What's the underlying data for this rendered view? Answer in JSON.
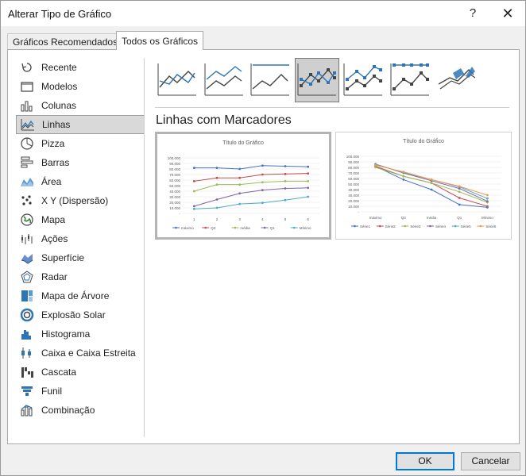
{
  "window": {
    "title": "Alterar Tipo de Gráfico",
    "help_label": "?",
    "close_label": "✕"
  },
  "tabs": [
    {
      "label": "Gráficos Recomendados",
      "selected": false
    },
    {
      "label": "Todos os Gráficos",
      "selected": true
    }
  ],
  "sidebar": {
    "items": [
      {
        "label": "Recente",
        "icon": "recent-icon"
      },
      {
        "label": "Modelos",
        "icon": "folder-icon"
      },
      {
        "label": "Colunas",
        "icon": "column-chart-icon"
      },
      {
        "label": "Linhas",
        "icon": "line-chart-icon",
        "selected": true
      },
      {
        "label": "Pizza",
        "icon": "pie-chart-icon"
      },
      {
        "label": "Barras",
        "icon": "bar-chart-icon"
      },
      {
        "label": "Área",
        "icon": "area-chart-icon"
      },
      {
        "label": "X Y (Dispersão)",
        "icon": "scatter-chart-icon"
      },
      {
        "label": "Mapa",
        "icon": "map-chart-icon"
      },
      {
        "label": "Ações",
        "icon": "stock-chart-icon"
      },
      {
        "label": "Superfície",
        "icon": "surface-chart-icon"
      },
      {
        "label": "Radar",
        "icon": "radar-chart-icon"
      },
      {
        "label": "Mapa de Árvore",
        "icon": "treemap-chart-icon"
      },
      {
        "label": "Explosão Solar",
        "icon": "sunburst-chart-icon"
      },
      {
        "label": "Histograma",
        "icon": "histogram-chart-icon"
      },
      {
        "label": "Caixa e Caixa Estreita",
        "icon": "box-whisker-chart-icon"
      },
      {
        "label": "Cascata",
        "icon": "waterfall-chart-icon"
      },
      {
        "label": "Funil",
        "icon": "funnel-chart-icon"
      },
      {
        "label": "Combinação",
        "icon": "combo-chart-icon"
      }
    ]
  },
  "subtypes": [
    {
      "icon": "line-icon"
    },
    {
      "icon": "stacked-line-icon"
    },
    {
      "icon": "100-stacked-line-icon"
    },
    {
      "icon": "line-with-markers-icon",
      "selected": true
    },
    {
      "icon": "stacked-line-with-markers-icon"
    },
    {
      "icon": "100-stacked-line-with-markers-icon"
    },
    {
      "icon": "3d-line-icon"
    }
  ],
  "selected_subtype_title": "Linhas com Marcadores",
  "colors": {
    "accent": "#0078d7",
    "series_blue": "#4472c4",
    "series_orange": "#ed7d31",
    "series_gray": "#a5a5a5",
    "series_yellow": "#ffc000",
    "series_lightblue": "#5b9bd5",
    "series_green": "#70ad47",
    "series_red": "#c0504d",
    "series_olive": "#9bbb59",
    "series_purple": "#8064a2",
    "series_teal": "#4bacc6",
    "series_amber": "#f79646"
  },
  "previews": [
    {
      "title": "Título do Gráfico",
      "y_ticks": [
        "100.000",
        "90.000",
        "80.000",
        "70.000",
        "60.000",
        "50.000",
        "40.000",
        "30.000",
        "20.000",
        "10.000",
        "-"
      ],
      "x_ticks": [
        "1",
        "2",
        "3",
        "4",
        "5",
        "6"
      ],
      "legend": [
        "máximo",
        "Q3",
        "média",
        "Q1",
        "Mínimo"
      ]
    },
    {
      "title": "Título do Gráfico",
      "y_ticks": [
        "100.000",
        "90.000",
        "80.000",
        "70.000",
        "60.000",
        "50.000",
        "40.000",
        "30.000",
        "20.000",
        "10.000",
        "-"
      ],
      "x_ticks": [
        "máximo",
        "Q3",
        "média",
        "Q1",
        "Mínimo"
      ],
      "legend": [
        "Série1",
        "Série2",
        "Série3",
        "Série4",
        "Série5",
        "Série6"
      ]
    }
  ],
  "chart_data": [
    {
      "type": "line",
      "title": "Título do Gráfico",
      "categories": [
        "1",
        "2",
        "3",
        "4",
        "5",
        "6"
      ],
      "ylim": [
        0,
        100000
      ],
      "series": [
        {
          "name": "máximo",
          "values": [
            82000,
            82000,
            80000,
            86000,
            85000,
            84000
          ]
        },
        {
          "name": "Q3",
          "values": [
            58000,
            64000,
            64000,
            70000,
            71000,
            72000
          ]
        },
        {
          "name": "média",
          "values": [
            40000,
            52000,
            52000,
            56000,
            58000,
            58000
          ]
        },
        {
          "name": "Q1",
          "values": [
            13000,
            25000,
            36000,
            42000,
            45000,
            46000
          ]
        },
        {
          "name": "Mínimo",
          "values": [
            8000,
            10000,
            17000,
            19000,
            24000,
            30000
          ]
        }
      ],
      "legend": "bottom"
    },
    {
      "type": "line",
      "title": "Título do Gráfico",
      "categories": [
        "máximo",
        "Q3",
        "média",
        "Q1",
        "Mínimo"
      ],
      "ylim": [
        0,
        100000
      ],
      "series": [
        {
          "name": "Série1",
          "values": [
            82000,
            58000,
            40000,
            13000,
            8000
          ]
        },
        {
          "name": "Série2",
          "values": [
            82000,
            64000,
            52000,
            25000,
            10000
          ]
        },
        {
          "name": "Série3",
          "values": [
            80000,
            64000,
            52000,
            36000,
            17000
          ]
        },
        {
          "name": "Série4",
          "values": [
            86000,
            70000,
            56000,
            42000,
            19000
          ]
        },
        {
          "name": "Série5",
          "values": [
            85000,
            71000,
            58000,
            45000,
            24000
          ]
        },
        {
          "name": "Série6",
          "values": [
            84000,
            72000,
            58000,
            46000,
            30000
          ]
        }
      ],
      "legend": "bottom"
    }
  ],
  "buttons": {
    "ok": "OK",
    "cancel": "Cancelar"
  }
}
